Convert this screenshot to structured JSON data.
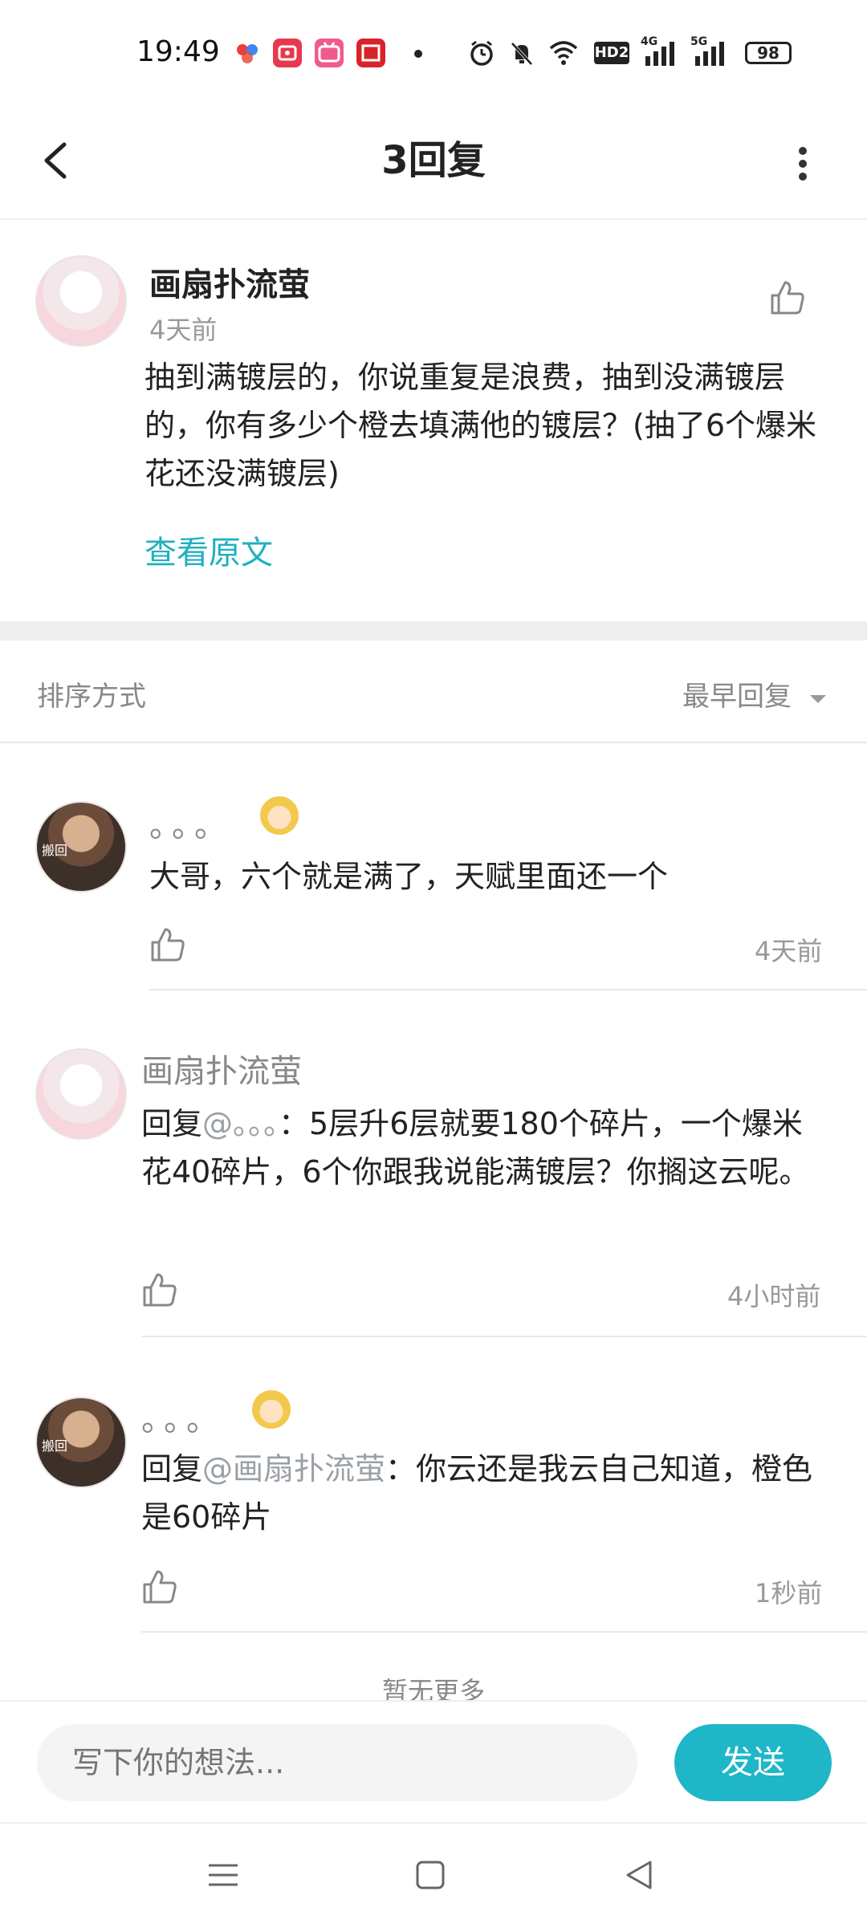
{
  "status_bar": {
    "time": "19:49",
    "app_icons": [
      "baidu-app-icon",
      "video-app-icon",
      "bilibili-app-icon",
      "zhihu-app-icon"
    ],
    "indicators": [
      "alarm-icon",
      "mute-icon",
      "wifi-icon",
      "hd-icon",
      "signal-4g-icon",
      "signal-5g-icon"
    ],
    "hd_label": "HD2",
    "net1": "4G",
    "net2": "5G",
    "battery": "98"
  },
  "header": {
    "title": "3回复"
  },
  "original_comment": {
    "username": "画扇扑流萤",
    "time": "4天前",
    "text": "抽到满镀层的，你说重复是浪费，抽到没满镀层的，你有多少个橙去填满他的镀层？(抽了6个爆米花还没满镀层)",
    "view_original": "查看原文"
  },
  "sort": {
    "label": "排序方式",
    "value": "最早回复"
  },
  "replies": [
    {
      "username": "。。。",
      "avatar_text": "搬回",
      "text": "大哥，六个就是满了，天赋里面还一个",
      "time": "4天前"
    },
    {
      "username": "画扇扑流萤",
      "reply_prefix": "回复",
      "mention": "@。。。",
      "text_after": "：5层升6层就要180个碎片，一个爆米花40碎片，6个你跟我说能满镀层？你搁这云呢。",
      "time": "4小时前"
    },
    {
      "username": "。。。",
      "avatar_text": "搬回",
      "reply_prefix": "回复",
      "mention": "@画扇扑流萤",
      "text_after": "：你云还是我云自己知道，橙色是60碎片",
      "time": "1秒前"
    }
  ],
  "no_more": "暂无更多",
  "input": {
    "placeholder": "写下你的想法...",
    "send_label": "发送"
  },
  "colors": {
    "accent": "#1fb7c7",
    "link": "#1fb0bf",
    "muted": "#999999"
  }
}
